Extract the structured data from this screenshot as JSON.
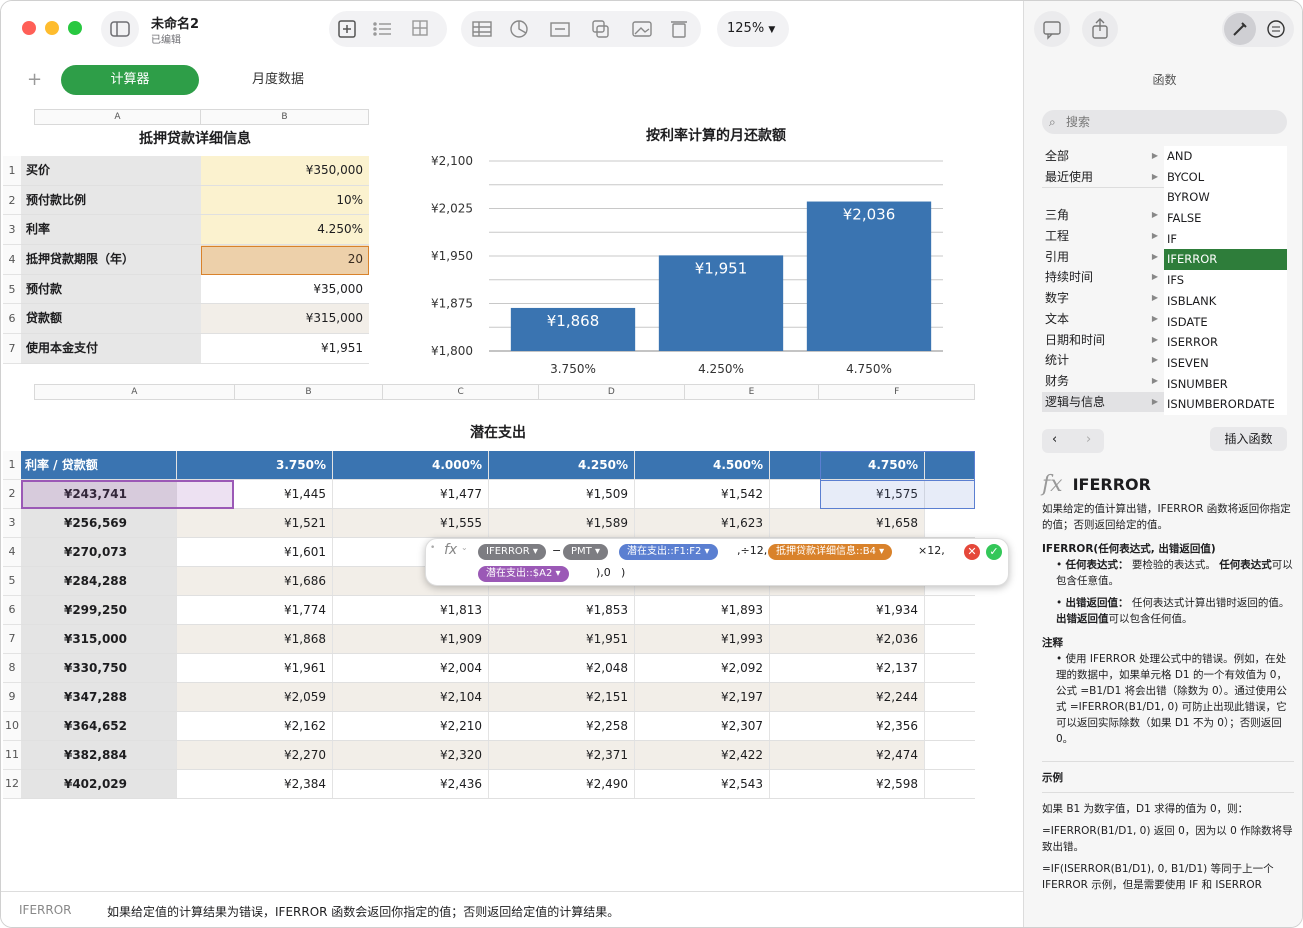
{
  "window": {
    "doc_title": "未命名2",
    "doc_subtitle": "已编辑",
    "zoom": "125%"
  },
  "sheets": {
    "add": "+",
    "active": "计算器",
    "other": "月度数据"
  },
  "table1": {
    "title": "抵押贷款详细信息",
    "col_headers": [
      "A",
      "B"
    ],
    "rows": [
      {
        "label": "买价",
        "value": "¥350,000"
      },
      {
        "label": "预付款比例",
        "value": "10%"
      },
      {
        "label": "利率",
        "value": "4.250%"
      },
      {
        "label": "抵押贷款期限（年）",
        "value": "20"
      },
      {
        "label": "预付款",
        "value": "¥35,000"
      },
      {
        "label": "贷款额",
        "value": "¥315,000"
      },
      {
        "label": "使用本金支付",
        "value": "¥1,951"
      }
    ],
    "row_numbers": [
      "1",
      "2",
      "3",
      "4",
      "5",
      "6",
      "7"
    ]
  },
  "chart_data": {
    "type": "bar",
    "title": "按利率计算的月还款额",
    "categories": [
      "3.750%",
      "4.250%",
      "4.750%"
    ],
    "values": [
      1868,
      1951,
      2036
    ],
    "labels": [
      "¥1,868",
      "¥1,951",
      "¥2,036"
    ],
    "ylim": [
      1800,
      2100
    ],
    "yticks": [
      "¥2,100",
      "¥2,025",
      "¥1,950",
      "¥1,875",
      "¥1,800"
    ],
    "color": "#3a74b1",
    "grid": true
  },
  "table2": {
    "title": "潜在支出",
    "col_headers": [
      "A",
      "B",
      "C",
      "D",
      "E",
      "F"
    ],
    "header": [
      "利率 / 贷款额",
      "3.750%",
      "4.000%",
      "4.250%",
      "4.500%",
      "4.750%"
    ],
    "rows": [
      [
        "¥243,741",
        "¥1,445",
        "¥1,477",
        "¥1,509",
        "¥1,542",
        "¥1,575"
      ],
      [
        "¥256,569",
        "¥1,521",
        "¥1,555",
        "¥1,589",
        "¥1,623",
        "¥1,658"
      ],
      [
        "¥270,073",
        "¥1,601",
        "",
        "",
        "",
        ""
      ],
      [
        "¥284,288",
        "¥1,686",
        "",
        "",
        "",
        ""
      ],
      [
        "¥299,250",
        "¥1,774",
        "¥1,813",
        "¥1,853",
        "¥1,893",
        "¥1,934"
      ],
      [
        "¥315,000",
        "¥1,868",
        "¥1,909",
        "¥1,951",
        "¥1,993",
        "¥2,036"
      ],
      [
        "¥330,750",
        "¥1,961",
        "¥2,004",
        "¥2,048",
        "¥2,092",
        "¥2,137"
      ],
      [
        "¥347,288",
        "¥2,059",
        "¥2,104",
        "¥2,151",
        "¥2,197",
        "¥2,244"
      ],
      [
        "¥364,652",
        "¥2,162",
        "¥2,210",
        "¥2,258",
        "¥2,307",
        "¥2,356"
      ],
      [
        "¥382,884",
        "¥2,270",
        "¥2,320",
        "¥2,371",
        "¥2,422",
        "¥2,474"
      ],
      [
        "¥402,029",
        "¥2,384",
        "¥2,436",
        "¥2,490",
        "¥2,543",
        "¥2,598"
      ]
    ],
    "row_numbers": [
      "1",
      "2",
      "3",
      "4",
      "5",
      "6",
      "7",
      "8",
      "9",
      "10",
      "11",
      "12"
    ]
  },
  "formula": {
    "fx": "fx",
    "iferror": "IFERROR",
    "minus": "−",
    "pmt": "PMT",
    "ref1": "潜在支出::F1:F2",
    "div12": ",÷12,",
    "ref2": "抵押贷款详细信息::B4",
    "times12": "×12,",
    "ref3": "潜在支出::$A2",
    "close": "),0",
    "close_last": ")"
  },
  "sidebar": {
    "title": "函数",
    "search_placeholder": "搜索",
    "categories": [
      "全部",
      "最近使用",
      "",
      "三角",
      "工程",
      "引用",
      "持续时间",
      "数字",
      "文本",
      "日期和时间",
      "统计",
      "财务",
      "逻辑与信息"
    ],
    "functions": [
      "AND",
      "BYCOL",
      "BYROW",
      "FALSE",
      "IF",
      "IFERROR",
      "IFS",
      "ISBLANK",
      "ISDATE",
      "ISERROR",
      "ISEVEN",
      "ISNUMBER",
      "ISNUMBERORDATE"
    ],
    "selected_function": "IFERROR",
    "insert_label": "插入函数",
    "func_name": "IFERROR",
    "func_desc": "如果给定的值计算出错，IFERROR 函数将返回你指定的值；否则返回给定的值。",
    "syntax": "IFERROR(任何表达式, 出错返回值)",
    "arg1_name": "任何表达式：",
    "arg1_desc": "要检验的表达式。",
    "arg1_name2": "任何表达式",
    "arg1_desc2": "可以包含任意值。",
    "arg2_name": "出错返回值：",
    "arg2_desc": "任何表达式计算出错时返回的值。",
    "arg2_name2": "出错返回值",
    "arg2_desc2": "可以包含任何值。",
    "notes_title": "注释",
    "note": "使用 IFERROR 处理公式中的错误。例如，在处理的数据中，如果单元格 D1 的一个有效值为 0，公式 =B1/D1 将会出错（除数为 0）。通过使用公式 =IFERROR(B1/D1, 0) 可防止出现此错误，它可以返回实际除数（如果 D1 不为 0）；否则返回 0。",
    "examples_title": "示例",
    "ex1": "如果 B1 为数字值，D1 求得的值为 0，则：",
    "ex2": "=IFERROR(B1/D1, 0) 返回 0，因为以 0 作除数将导致出错。",
    "ex3": "=IF(ISERROR(B1/D1), 0, B1/D1) 等同于上一个 IFERROR 示例，但是需要使用 IF 和 ISERROR"
  },
  "bottom": {
    "func": "IFERROR",
    "desc": "如果给定值的计算结果为错误，IFERROR 函数会返回你指定的值；否则返回给定值的计算结果。"
  }
}
